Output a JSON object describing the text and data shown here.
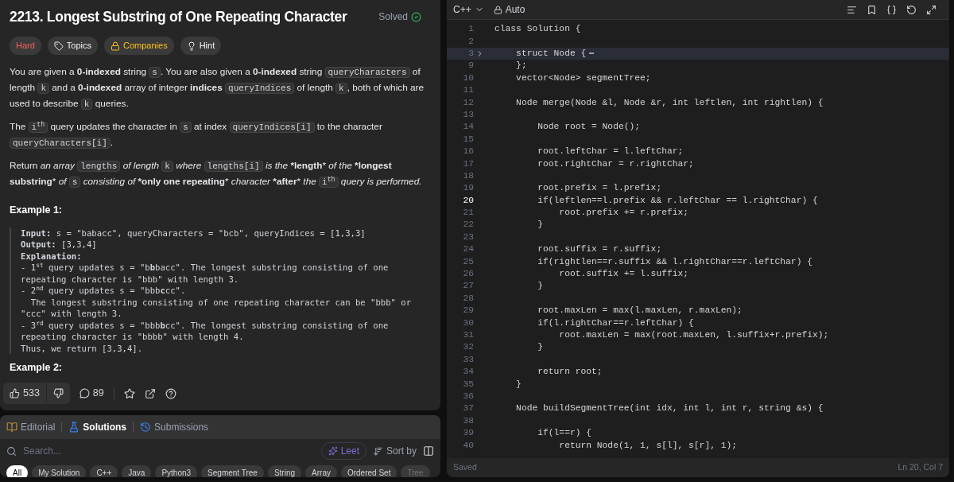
{
  "problem": {
    "title": "2213. Longest Substring of One Repeating Character",
    "status": "Solved",
    "tags": [
      {
        "kind": "difficulty",
        "label": "Hard"
      },
      {
        "kind": "topics",
        "label": "Topics"
      },
      {
        "kind": "companies",
        "label": "Companies"
      },
      {
        "kind": "hint",
        "label": "Hint"
      }
    ],
    "paragraphs": [
      [
        {
          "kind": "text",
          "text": "You are given a **0-indexed** string "
        },
        {
          "kind": "code",
          "text": "s"
        },
        {
          "kind": "text",
          "text": ". You are also given a **0-indexed** string "
        },
        {
          "kind": "code",
          "text": "queryCharacters"
        },
        {
          "kind": "text",
          "text": " of length "
        },
        {
          "kind": "code",
          "text": "k"
        },
        {
          "kind": "text",
          "text": " and a **0-indexed** array of integer **indices** "
        },
        {
          "kind": "code",
          "text": "queryIndices"
        },
        {
          "kind": "text",
          "text": " of length "
        },
        {
          "kind": "code",
          "text": "k"
        },
        {
          "kind": "text",
          "text": ", both of which are used to describe "
        },
        {
          "kind": "code",
          "text": "k"
        },
        {
          "kind": "text",
          "text": " queries."
        }
      ],
      [
        {
          "kind": "text",
          "text": "The "
        },
        {
          "kind": "code",
          "text": "i$^{th}$"
        },
        {
          "kind": "text",
          "text": " query updates the character in "
        },
        {
          "kind": "code",
          "text": "s"
        },
        {
          "kind": "text",
          "text": " at index "
        },
        {
          "kind": "code",
          "text": "queryIndices[i]"
        },
        {
          "kind": "text",
          "text": " to the character "
        },
        {
          "kind": "code",
          "text": "queryCharacters[i]"
        },
        {
          "kind": "text",
          "text": "."
        }
      ],
      [
        {
          "kind": "text",
          "text": "Return *an array* "
        },
        {
          "kind": "code",
          "text": "lengths"
        },
        {
          "kind": "text",
          "text": " *of length* "
        },
        {
          "kind": "code",
          "text": "k"
        },
        {
          "kind": "text",
          "text": " *where* "
        },
        {
          "kind": "code",
          "text": "lengths[i]"
        },
        {
          "kind": "text",
          "text": " *is the* ***length*** *of the* ***longest substring*** *of* "
        },
        {
          "kind": "code",
          "text": "s"
        },
        {
          "kind": "text",
          "text": " *consisting of* ***only one repeating*** *character* ***after*** *the* "
        },
        {
          "kind": "code",
          "text": "i$^{th}$"
        },
        {
          "kind": "text",
          "text": " *query is performed.*"
        }
      ]
    ],
    "examples": [
      {
        "title": "Example 1:",
        "lines": [
          "**Input:** s = \"babacc\", queryCharacters = \"bcb\", queryIndices = [1,3,3]",
          "**Output:** [3,3,4]",
          "**Explanation:**",
          "- 1$^{st}$ query updates s = \"b**b**bacc\". The longest substring consisting of one repeating character is \"bbb\" with length 3.",
          "- 2$^{nd}$ query updates s = \"bbb**c**cc\".",
          "  The longest substring consisting of one repeating character can be \"bbb\" or \"ccc\" with length 3.",
          "- 3$^{rd}$ query updates s = \"bbb**b**cc\". The longest substring consisting of one repeating character is \"bbbb\" with length 4.",
          "Thus, we return [3,3,4]."
        ]
      },
      {
        "title": "Example 2:"
      }
    ],
    "likes": "533",
    "comments": "89"
  },
  "solutions_panel": {
    "tabs": [
      {
        "kind": "editorial",
        "label": "Editorial",
        "selected": false
      },
      {
        "kind": "solutions",
        "label": "Solutions",
        "selected": true
      },
      {
        "kind": "submissions",
        "label": "Submissions",
        "selected": false
      }
    ],
    "search": {
      "placeholder": "Search..."
    },
    "leet_button": "Leet",
    "sort_button": "Sort by",
    "filters": [
      {
        "label": "All",
        "selected": true
      },
      {
        "label": "My Solution",
        "selected": false
      },
      {
        "label": "C++",
        "selected": false
      },
      {
        "label": "Java",
        "selected": false
      },
      {
        "label": "Python3",
        "selected": false
      },
      {
        "label": "Segment Tree",
        "selected": false
      },
      {
        "label": "String",
        "selected": false
      },
      {
        "label": "Array",
        "selected": false
      },
      {
        "label": "Ordered Set",
        "selected": false
      },
      {
        "label": "Tree",
        "selected": false,
        "disabled": true
      }
    ]
  },
  "editor": {
    "language": "C++",
    "mode": "Auto",
    "lines": [
      {
        "n": "1",
        "text": "class Solution {"
      },
      {
        "n": "2"
      },
      {
        "n": "3",
        "text": "    struct Node {",
        "folded": true
      },
      {
        "n": "9",
        "text": "    };"
      },
      {
        "n": "10",
        "text": "    vector<Node> segmentTree;"
      },
      {
        "n": "11"
      },
      {
        "n": "12",
        "text": "    Node merge(Node &l, Node &r, int leftlen, int rightlen) {"
      },
      {
        "n": "13"
      },
      {
        "n": "14",
        "text": "        Node root = Node();"
      },
      {
        "n": "15"
      },
      {
        "n": "16",
        "text": "        root.leftChar = l.leftChar;"
      },
      {
        "n": "17",
        "text": "        root.rightChar = r.rightChar;"
      },
      {
        "n": "18"
      },
      {
        "n": "19",
        "text": "        root.prefix = l.prefix;"
      },
      {
        "n": "20",
        "text": "        if(leftlen==l.prefix && r.leftChar == l.rightChar) {",
        "current": true
      },
      {
        "n": "21",
        "text": "            root.prefix += r.prefix;"
      },
      {
        "n": "22",
        "text": "        }"
      },
      {
        "n": "23"
      },
      {
        "n": "24",
        "text": "        root.suffix = r.suffix;"
      },
      {
        "n": "25",
        "text": "        if(rightlen==r.suffix && l.rightChar==r.leftChar) {"
      },
      {
        "n": "26",
        "text": "            root.suffix += l.suffix;"
      },
      {
        "n": "27",
        "text": "        }"
      },
      {
        "n": "28"
      },
      {
        "n": "29",
        "text": "        root.maxLen = max(l.maxLen, r.maxLen);"
      },
      {
        "n": "30",
        "text": "        if(l.rightChar==r.leftChar) {"
      },
      {
        "n": "31",
        "text": "            root.maxLen = max(root.maxLen, l.suffix+r.prefix);"
      },
      {
        "n": "32",
        "text": "        }"
      },
      {
        "n": "33"
      },
      {
        "n": "34",
        "text": "        return root;"
      },
      {
        "n": "35",
        "text": "    }"
      },
      {
        "n": "36"
      },
      {
        "n": "37",
        "text": "    Node buildSegmentTree(int idx, int l, int r, string &s) {"
      },
      {
        "n": "38"
      },
      {
        "n": "39",
        "text": "        if(l==r) {"
      },
      {
        "n": "40",
        "text": "            return Node(1, 1, s[l], s[r], 1);"
      }
    ],
    "status": "Saved",
    "cursor": "Ln 20, Col 7"
  }
}
